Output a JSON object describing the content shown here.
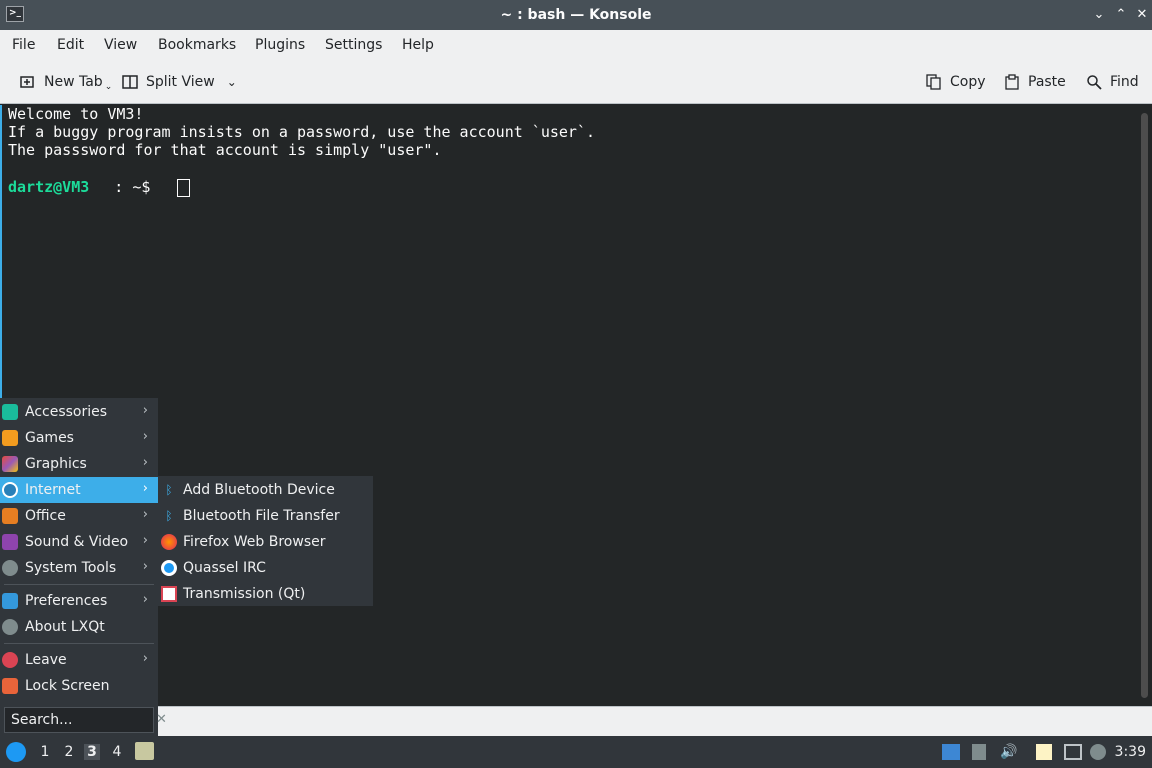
{
  "window": {
    "title": "~ : bash — Konsole",
    "minimize": "⌄",
    "maximize": "⌃",
    "close": "✕"
  },
  "menubar": [
    "File",
    "Edit",
    "View",
    "Bookmarks",
    "Plugins",
    "Settings",
    "Help"
  ],
  "toolbar": {
    "new_tab": "New Tab",
    "split_view": "Split View",
    "copy": "Copy",
    "paste": "Paste",
    "find": "Find"
  },
  "terminal": {
    "lines": [
      "Welcome to VM3!",
      "If a buggy program insists on a password, use the account `user`.",
      "The passsword for that account is simply \"user\"."
    ],
    "prompt_user": "dartz@VM3",
    "prompt_path": " : ~$"
  },
  "app_menu": {
    "items": [
      "Accessories",
      "Games",
      "Graphics",
      "Internet",
      "Office",
      "Sound & Video",
      "System Tools"
    ],
    "items2": [
      "Preferences",
      "About LXQt"
    ],
    "items3": [
      "Leave",
      "Lock Screen"
    ],
    "search_placeholder": "Search...",
    "selected": "Internet"
  },
  "submenu": [
    "Add Bluetooth Device",
    "Bluetooth File Transfer",
    "Firefox Web Browser",
    "Quassel IRC",
    "Transmission (Qt)"
  ],
  "taskbar": {
    "desktops": [
      "1",
      "2",
      "3",
      "4"
    ],
    "active_desktop": "3",
    "clock": "3:39"
  },
  "colors": {
    "accent": "#3daee9",
    "prompt": "#1cdc9a",
    "terminal_bg": "#232627",
    "panel": "#31363b"
  }
}
